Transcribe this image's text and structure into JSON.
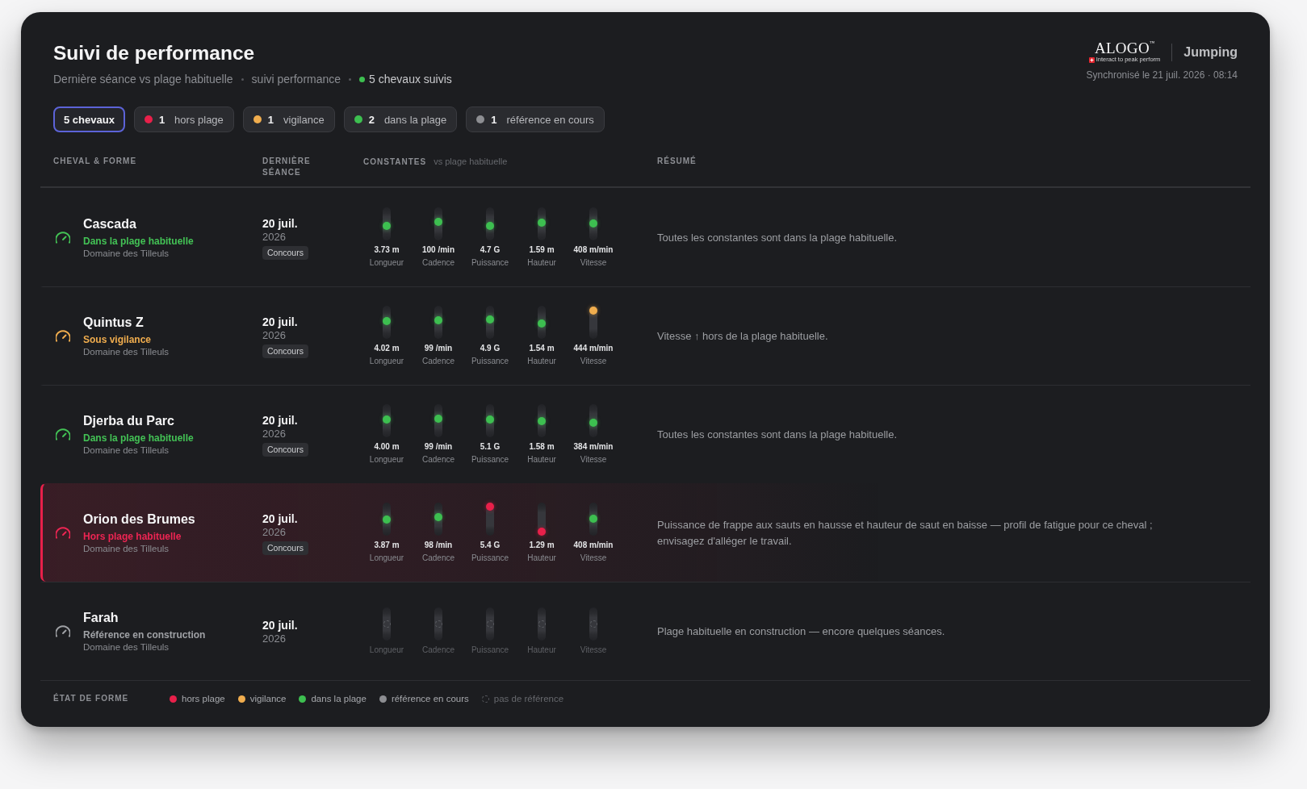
{
  "header": {
    "title": "Suivi de performance",
    "subtitle": [
      "Dernière séance vs plage habituelle",
      "suivi performance"
    ],
    "live": {
      "label": "5 chevaux suivis",
      "color": "#3dbf50"
    },
    "brand": {
      "wordmark": "ALOGO$^{™}$",
      "tagline": "Interact to peak perform",
      "product": "Jumping"
    },
    "sync": "Synchronisé le 21 juil. 2026 · 08:14"
  },
  "filters": [
    {
      "kind": "total",
      "label": "5 chevaux",
      "selected": true
    },
    {
      "kind": "status",
      "color": "#e8204a",
      "count": "1",
      "label": "hors plage",
      "selected": false
    },
    {
      "kind": "status",
      "color": "#f0ad4e",
      "count": "1",
      "label": "vigilance",
      "selected": false
    },
    {
      "kind": "status",
      "color": "#3dbf50",
      "count": "2",
      "label": "dans la plage",
      "selected": false
    },
    {
      "kind": "status",
      "color": "#8d8e92",
      "count": "1",
      "label": "référence en cours",
      "selected": false
    }
  ],
  "table": {
    "columns": [
      {
        "label": "CHEVAL & FORME"
      },
      {
        "label": "DERNIÈRE SÉANCE"
      },
      {
        "label": "CONSTANTES",
        "note": "vs plage habituelle"
      },
      {
        "label": "RÉSUMÉ"
      }
    ],
    "rows": [
      {
        "name": "Cascada",
        "color": "#43c255",
        "alert": false,
        "status_label": "Dans la plage habituelle",
        "stable": "Domaine des Tilleuls",
        "date": "20 juil.",
        "year": "2026",
        "tag": "Concours",
        "metrics": [
          {
            "kind": "dot",
            "label": "Longueur",
            "value": "3.73 m",
            "color": "#3dbf50",
            "level": 0.43
          },
          {
            "kind": "dot",
            "label": "Cadence",
            "value": "100 /min",
            "color": "#3dbf50",
            "level": 0.59
          },
          {
            "kind": "dot",
            "label": "Puissance",
            "value": "4.7 G",
            "color": "#3dbf50",
            "level": 0.41
          },
          {
            "kind": "dot",
            "label": "Hauteur",
            "value": "1.59 m",
            "color": "#3dbf50",
            "level": 0.56
          },
          {
            "kind": "dot",
            "label": "Vitesse",
            "value": "408 m/min",
            "color": "#3dbf50",
            "level": 0.51
          }
        ],
        "summary": "Toutes les constantes sont dans la plage habituelle."
      },
      {
        "name": "Quintus Z",
        "color": "#f0ad4e",
        "alert": false,
        "status_label": "Sous vigilance",
        "stable": "Domaine des Tilleuls",
        "date": "20 juil.",
        "year": "2026",
        "tag": "Concours",
        "metrics": [
          {
            "kind": "dot",
            "label": "Longueur",
            "value": "4.02 m",
            "color": "#3dbf50",
            "level": 0.54
          },
          {
            "kind": "dot",
            "label": "Cadence",
            "value": "99 /min",
            "color": "#3dbf50",
            "level": 0.59
          },
          {
            "kind": "dot",
            "label": "Puissance",
            "value": "4.9 G",
            "color": "#3dbf50",
            "level": 0.62
          },
          {
            "kind": "dot",
            "label": "Hauteur",
            "value": "1.54 m",
            "color": "#3dbf50",
            "level": 0.45
          },
          {
            "kind": "dot",
            "label": "Vitesse",
            "value": "444 m/min",
            "color": "#f0ad4e",
            "level": 0.97
          }
        ],
        "summary": "Vitesse ↑ hors de la plage habituelle."
      },
      {
        "name": "Djerba du Parc",
        "color": "#43c255",
        "alert": false,
        "status_label": "Dans la plage habituelle",
        "stable": "Domaine des Tilleuls",
        "date": "20 juil.",
        "year": "2026",
        "tag": "Concours",
        "metrics": [
          {
            "kind": "dot",
            "label": "Longueur",
            "value": "4.00 m",
            "color": "#3dbf50",
            "level": 0.55
          },
          {
            "kind": "dot",
            "label": "Cadence",
            "value": "99 /min",
            "color": "#3dbf50",
            "level": 0.58
          },
          {
            "kind": "dot",
            "label": "Puissance",
            "value": "5.1 G",
            "color": "#3dbf50",
            "level": 0.55
          },
          {
            "kind": "dot",
            "label": "Hauteur",
            "value": "1.58 m",
            "color": "#3dbf50",
            "level": 0.48
          },
          {
            "kind": "dot",
            "label": "Vitesse",
            "value": "384 m/min",
            "color": "#3dbf50",
            "level": 0.41
          }
        ],
        "summary": "Toutes les constantes sont dans la plage habituelle."
      },
      {
        "name": "Orion des Brumes",
        "color": "#ee2553",
        "alert": true,
        "status_label": "Hors plage habituelle",
        "stable": "Domaine des Tilleuls",
        "date": "20 juil.",
        "year": "2026",
        "tag": "Concours",
        "metrics": [
          {
            "kind": "dot",
            "label": "Longueur",
            "value": "3.87 m",
            "color": "#3dbf50",
            "level": 0.47
          },
          {
            "kind": "dot",
            "label": "Cadence",
            "value": "98 /min",
            "color": "#3dbf50",
            "level": 0.58
          },
          {
            "kind": "dot",
            "label": "Puissance",
            "value": "5.4 G",
            "color": "#e8204a",
            "level": 1
          },
          {
            "kind": "dot",
            "label": "Hauteur",
            "value": "1.29 m",
            "color": "#e8204a",
            "level": 0
          },
          {
            "kind": "dot",
            "label": "Vitesse",
            "value": "408 m/min",
            "color": "#3dbf50",
            "level": 0.53
          }
        ],
        "summary": "Puissance de frappe aux sauts en hausse et hauteur de saut en baisse — profil de fatigue pour ce cheval ; envisagez d'alléger le travail."
      },
      {
        "name": "Farah",
        "color": "#9fa1a5",
        "alert": false,
        "status_label": "Référence en construction",
        "stable": "Domaine des Tilleuls",
        "date": "20 juil.",
        "year": "2026",
        "metrics": [
          {
            "kind": "pending",
            "label": "Longueur"
          },
          {
            "kind": "pending",
            "label": "Cadence"
          },
          {
            "kind": "pending",
            "label": "Puissance"
          },
          {
            "kind": "pending",
            "label": "Hauteur"
          },
          {
            "kind": "pending",
            "label": "Vitesse"
          }
        ],
        "summary": "Plage habituelle en construction — encore quelques séances."
      }
    ]
  },
  "legend": {
    "title": "ÉTAT DE FORME",
    "items": [
      {
        "kind": "dot",
        "color": "#e8204a",
        "label": "hors plage"
      },
      {
        "kind": "dot",
        "color": "#f0ad4e",
        "label": "vigilance"
      },
      {
        "kind": "dot",
        "color": "#3dbf50",
        "label": "dans la plage"
      },
      {
        "kind": "dot",
        "color": "#8d8e92",
        "label": "référence en cours"
      },
      {
        "kind": "pending",
        "label": "pas de référence"
      }
    ]
  }
}
